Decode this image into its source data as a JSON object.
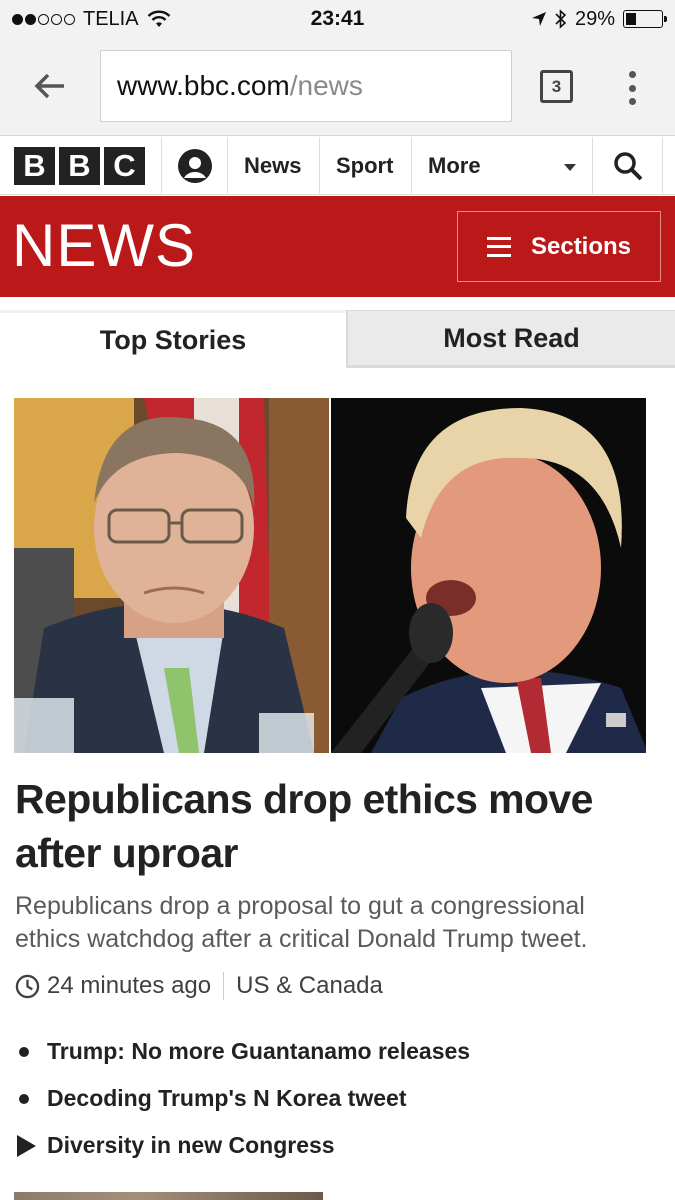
{
  "status_bar": {
    "carrier": "TELIA",
    "time": "23:41",
    "battery_percent": "29%",
    "battery_level": 0.29
  },
  "browser": {
    "url_host": "www.bbc.com",
    "url_path": "/news",
    "tab_count": "3"
  },
  "bbc_nav": {
    "logo_letters": [
      "B",
      "B",
      "C"
    ],
    "items": [
      "News",
      "Sport",
      "More"
    ]
  },
  "masthead": {
    "title": "NEWS",
    "sections_label": "Sections"
  },
  "tabs": {
    "top_stories": "Top Stories",
    "most_read": "Most Read"
  },
  "story": {
    "headline": "Republicans drop ethics move after uproar",
    "summary": "Republicans drop a proposal to gut a congressional ethics watchdog after a critical Donald Trump tweet.",
    "time": "24 minutes ago",
    "section": "US & Canada",
    "related": [
      {
        "label": "Trump: No more Guantanamo releases",
        "marker": "bullet"
      },
      {
        "label": "Decoding Trump's N Korea tweet",
        "marker": "bullet"
      },
      {
        "label": "Diversity in new Congress",
        "marker": "play"
      }
    ]
  },
  "colors": {
    "bbc_news_red": "#bb1919",
    "chrome_gray": "#f2f2f2"
  }
}
